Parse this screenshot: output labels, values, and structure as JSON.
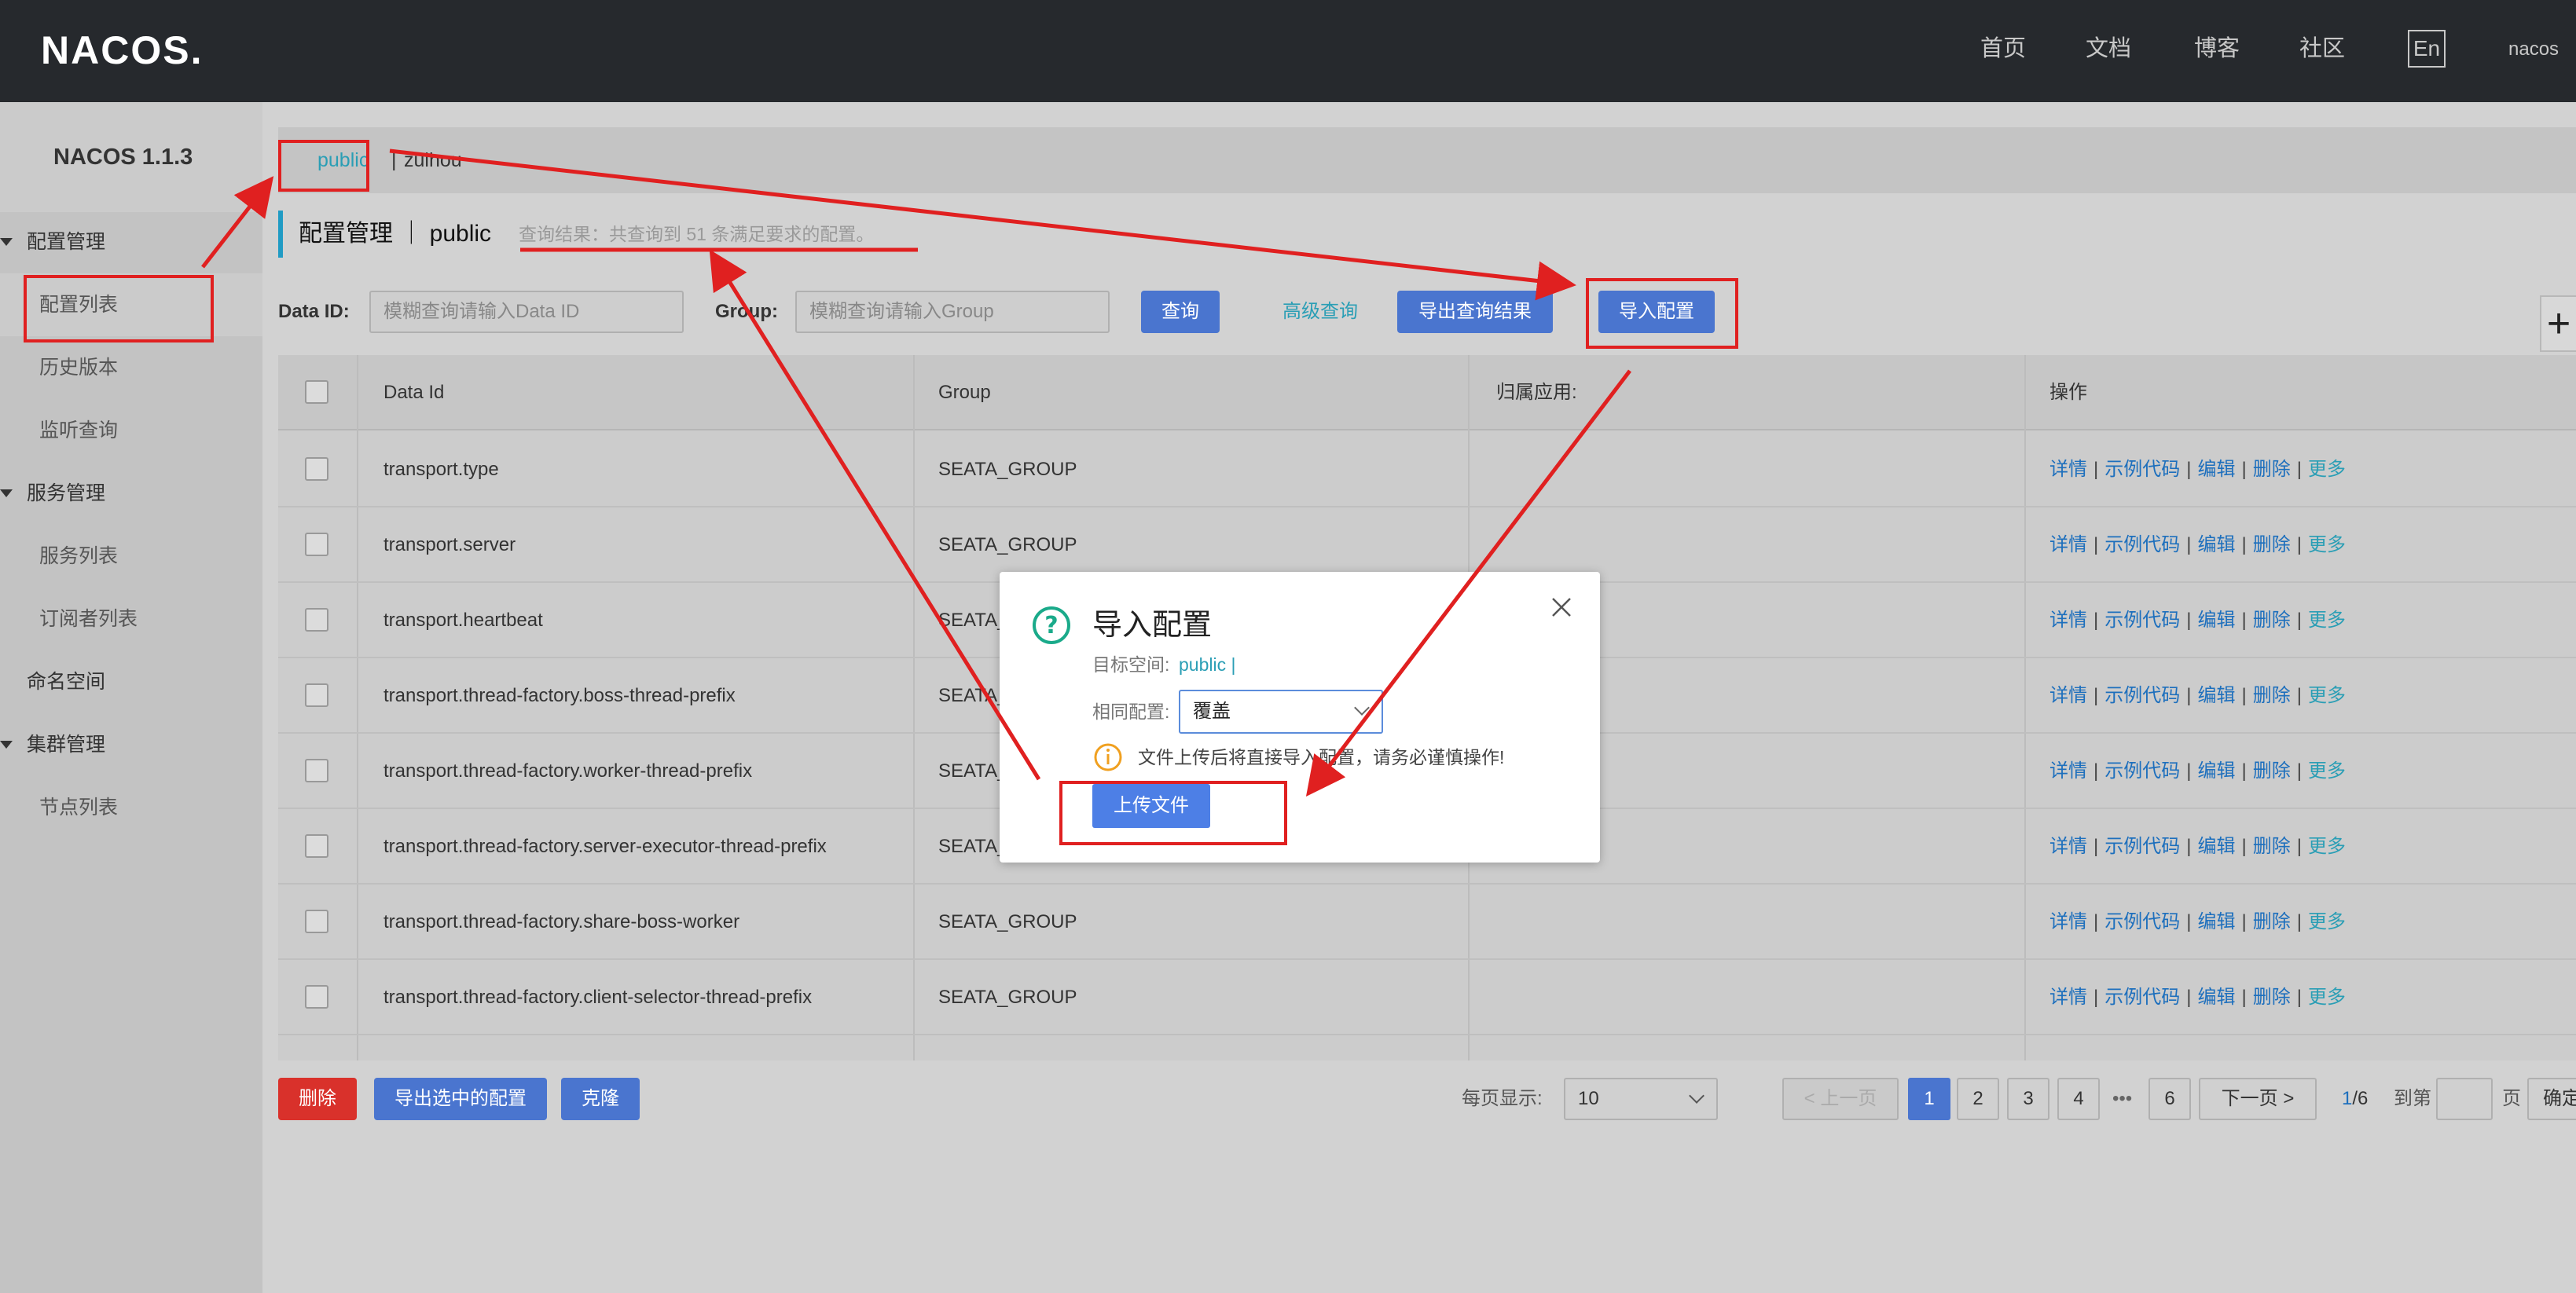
{
  "header": {
    "logo": "NACOS.",
    "nav": [
      "首页",
      "文档",
      "博客",
      "社区"
    ],
    "lang": "En",
    "user": "nacos"
  },
  "sidebar": {
    "version": "NACOS 1.1.3",
    "groups": [
      {
        "label": "配置管理",
        "items": [
          "配置列表",
          "历史版本",
          "监听查询"
        ]
      },
      {
        "label": "服务管理",
        "items": [
          "服务列表",
          "订阅者列表"
        ]
      },
      {
        "label": "命名空间",
        "items": []
      },
      {
        "label": "集群管理",
        "items": [
          "节点列表"
        ]
      }
    ]
  },
  "namespace_bar": {
    "public": "public",
    "separator": "|",
    "other": "zuihou"
  },
  "page": {
    "title": "配置管理 ｜ public",
    "query_result": "查询结果：共查询到 51 条满足要求的配置。"
  },
  "filters": {
    "data_id_label": "Data ID:",
    "data_id_placeholder": "模糊查询请输入Data ID",
    "group_label": "Group:",
    "group_placeholder": "模糊查询请输入Group",
    "query_button": "查询",
    "advanced_query": "高级查询",
    "export_result_button": "导出查询结果",
    "import_button": "导入配置"
  },
  "table": {
    "headers": [
      "Data Id",
      "Group",
      "归属应用:",
      "操作"
    ],
    "ops": [
      "详情",
      "示例代码",
      "编辑",
      "删除",
      "更多"
    ],
    "rows": [
      {
        "data_id": "transport.type",
        "group": "SEATA_GROUP"
      },
      {
        "data_id": "transport.server",
        "group": "SEATA_GROUP"
      },
      {
        "data_id": "transport.heartbeat",
        "group": "SEATA_"
      },
      {
        "data_id": "transport.thread-factory.boss-thread-prefix",
        "group": "SEATA_"
      },
      {
        "data_id": "transport.thread-factory.worker-thread-prefix",
        "group": "SEATA_"
      },
      {
        "data_id": "transport.thread-factory.server-executor-thread-prefix",
        "group": "SEATA_"
      },
      {
        "data_id": "transport.thread-factory.share-boss-worker",
        "group": "SEATA_GROUP"
      },
      {
        "data_id": "transport.thread-factory.client-selector-thread-prefix",
        "group": "SEATA_GROUP"
      }
    ]
  },
  "bottom": {
    "delete_button": "删除",
    "export_selected_button": "导出选中的配置",
    "clone_button": "克隆",
    "page_size_label": "每页显示:",
    "page_size": "10",
    "prev": "< 上一页",
    "pages": [
      "1",
      "2",
      "3",
      "4"
    ],
    "ellipsis": "•••",
    "last_page": "6",
    "next": "下一页 >",
    "current": "1",
    "total": "/6",
    "goto_label": "到第",
    "page_unit": "页",
    "confirm": "确定"
  },
  "modal": {
    "title": "导入配置",
    "target_label": "目标空间:",
    "target_value": "public |",
    "same_config_label": "相同配置:",
    "same_config_value": "覆盖",
    "warning": "文件上传后将直接导入配置，请务必谨慎操作!",
    "upload_button": "上传文件"
  },
  "colors": {
    "topbar": "#26292d",
    "accent_blue": "#4a75cf",
    "link_teal": "#2a9eb5",
    "danger": "#d9312b",
    "annotation": "#e02020",
    "warning": "#f0a020"
  }
}
